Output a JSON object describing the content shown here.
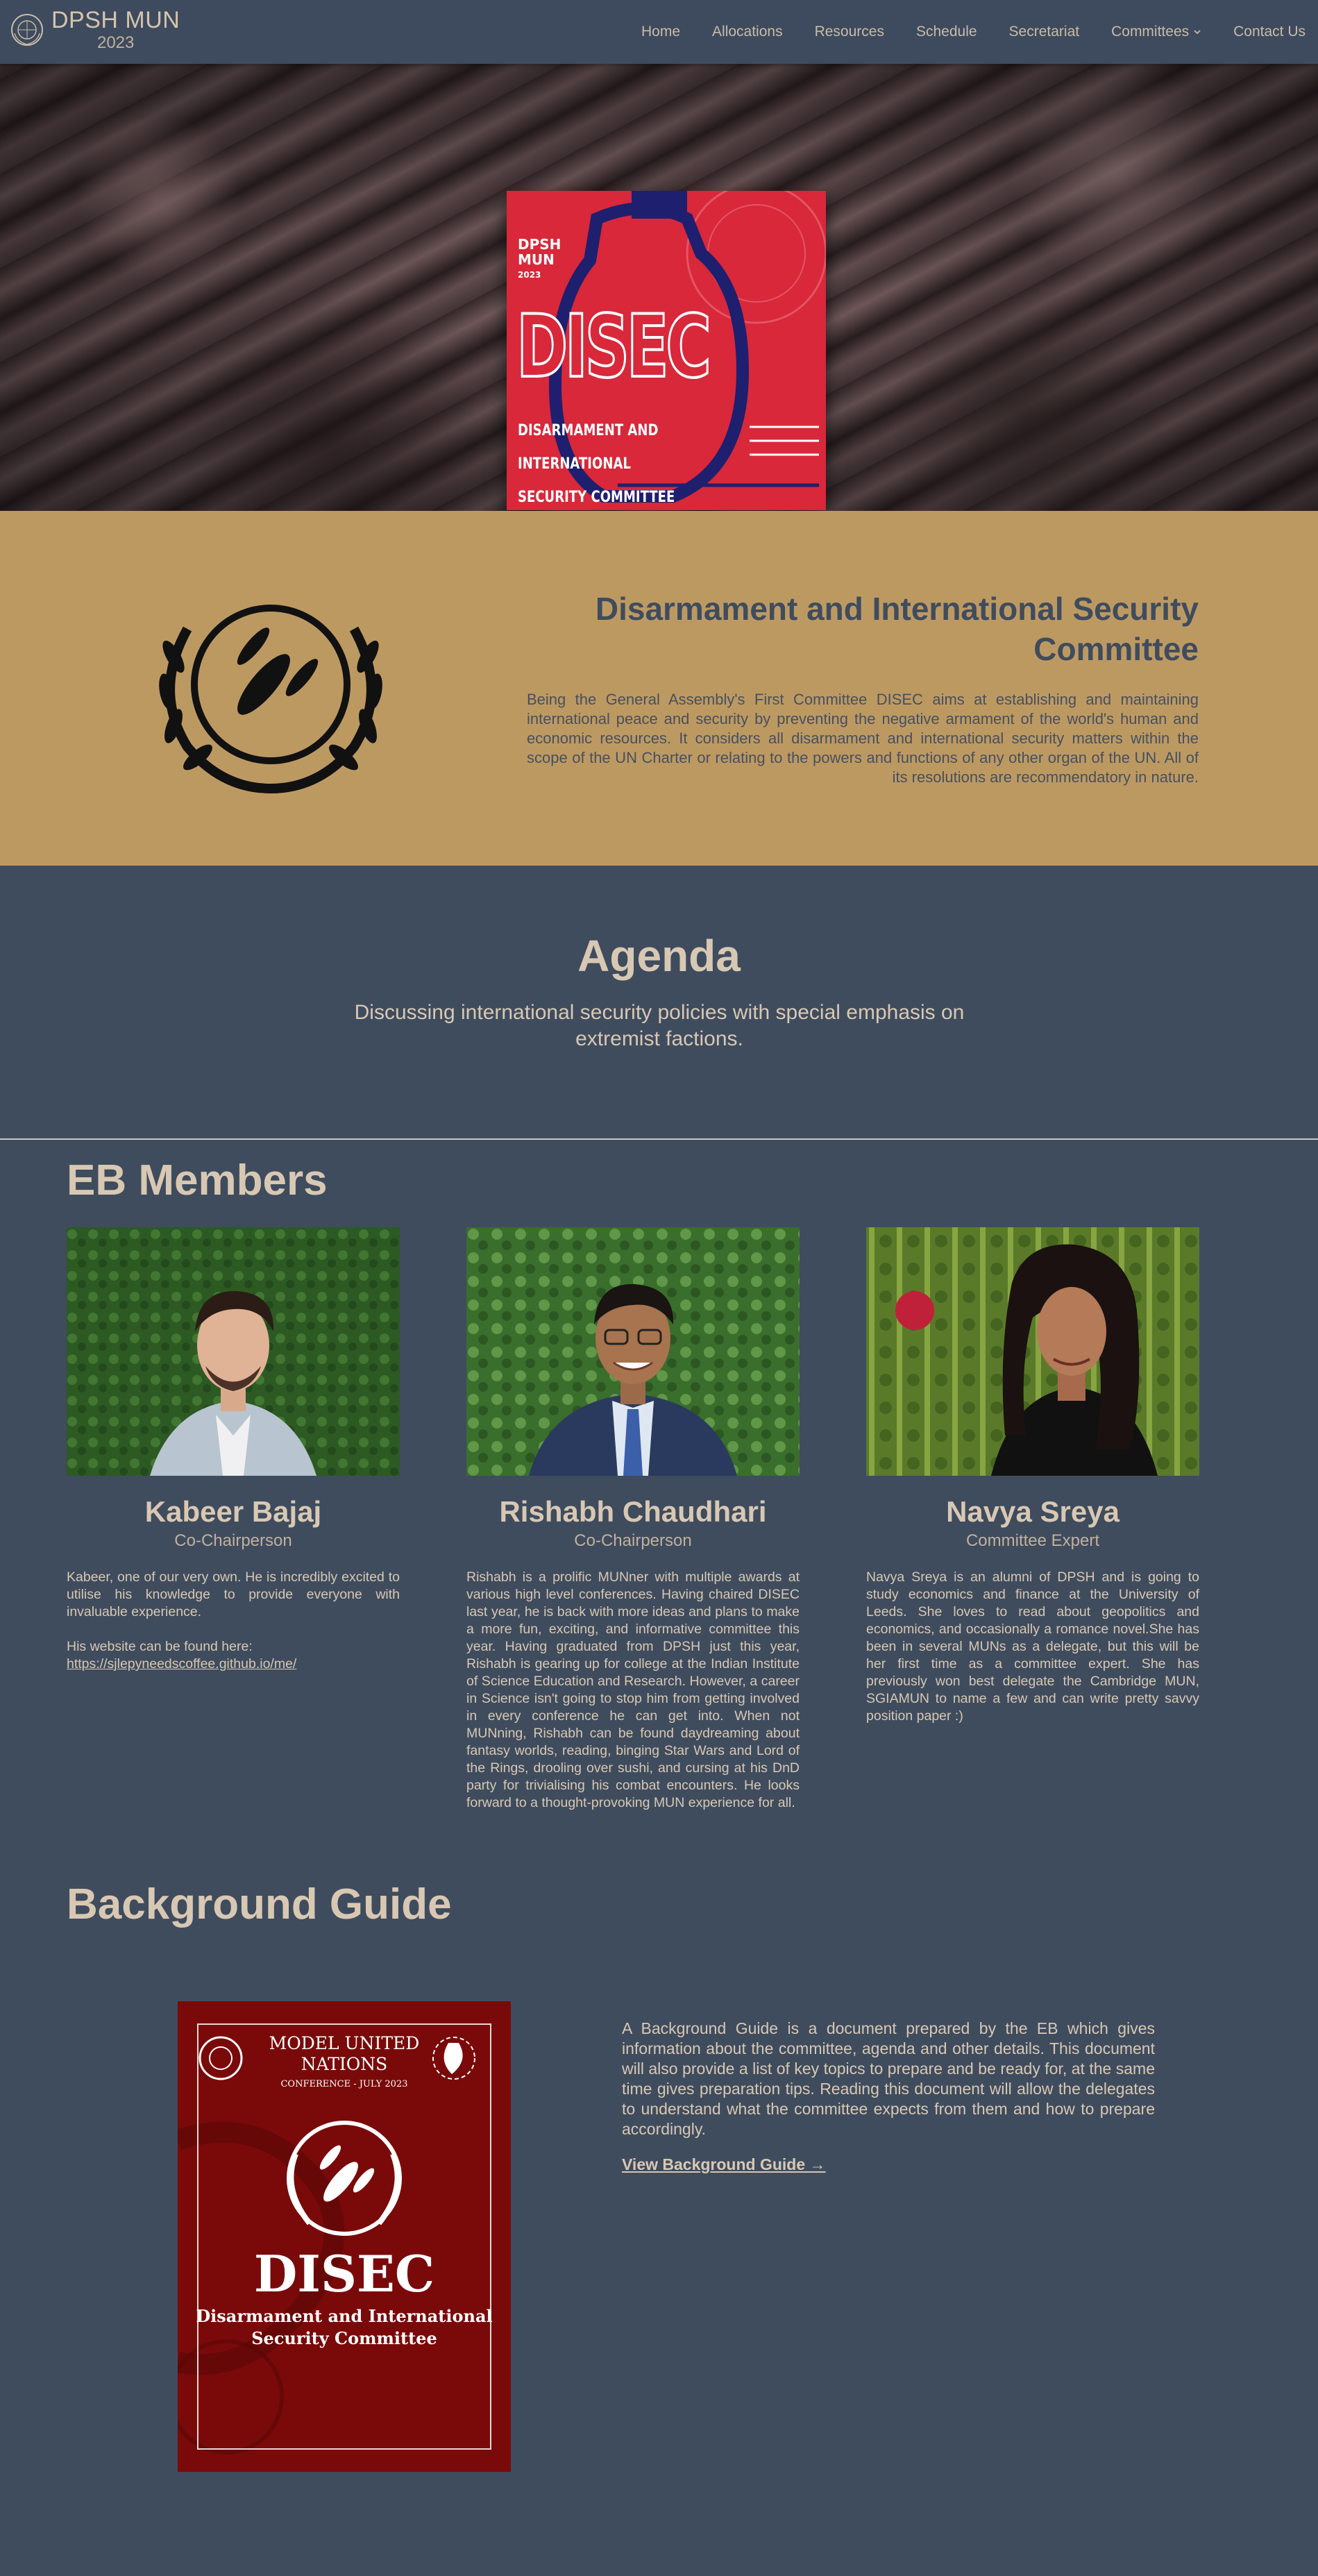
{
  "nav": {
    "brand_name": "DPSH MUN",
    "brand_year": "2023",
    "links": [
      {
        "label": "Home"
      },
      {
        "label": "Allocations"
      },
      {
        "label": "Resources"
      },
      {
        "label": "Schedule"
      },
      {
        "label": "Secretariat"
      },
      {
        "label": "Committees"
      },
      {
        "label": "Contact Us"
      }
    ]
  },
  "hero": {
    "poster_org": "DPSH",
    "poster_org2": "MUN",
    "poster_year": "2023",
    "poster_title": "DISEC",
    "poster_sub1": "DISARMAMENT AND INTERNATIONAL",
    "poster_sub2": "SECURITY COMMITTEE"
  },
  "about": {
    "title": "Disarmament and International Security Committee",
    "text": "Being the General Assembly's First Committee DISEC aims at establishing and maintaining international peace and security by preventing the negative armament of the world's human and economic resources. It considers all disarmament and international security matters within the scope of the UN Charter or relating to the powers and functions of any other organ of the UN. All of its resolutions are recommendatory in nature."
  },
  "agenda": {
    "title": "Agenda",
    "text": "Discussing international security policies with special emphasis on extremist factions."
  },
  "eb": {
    "title": "EB Members",
    "members": [
      {
        "name": "Kabeer Bajaj",
        "role": "Co-Chairperson",
        "bio": "Kabeer, one of our very own. He is incredibly excited to utilise his knowledge to provide everyone with invaluable experience.",
        "bio2": "His website can be found here:",
        "link": "https://sjlepyneedscoffee.github.io/me/"
      },
      {
        "name": "Rishabh Chaudhari",
        "role": "Co-Chairperson",
        "bio": "Rishabh is a prolific MUNner with multiple awards at various high level conferences. Having chaired DISEC last year, he is back with more ideas and plans to make a more fun, exciting, and informative committee this year. Having graduated from DPSH just this year, Rishabh is gearing up for college at the Indian Institute of Science Education and Research. However, a career in Science isn't going to stop him from getting involved in every conference he can get into. When not MUNning, Rishabh can be found daydreaming about fantasy worlds, reading, binging Star Wars and Lord of the Rings, drooling over sushi, and cursing at his DnD party for trivialising his combat encounters. He looks forward to a thought-provoking MUN experience for all."
      },
      {
        "name": "Navya Sreya",
        "role": "Committee Expert",
        "bio": "Navya Sreya is an alumni of DPSH and is going to study economics and finance at the University of Leeds. She loves to read about geopolitics and economics, and occasionally a romance novel.She has been in several MUNs as a delegate, but this will be her first time as a committee expert. She has previously won best delegate the Cambridge MUN, SGIAMUN to name a few and can write pretty savvy position paper :)"
      }
    ]
  },
  "background_guide": {
    "title": "Background Guide",
    "cover_line1": "MODEL UNITED",
    "cover_line2": "NATIONS",
    "cover_conf": "CONFERENCE - JULY 2023",
    "cover_title": "DISEC",
    "cover_full1": "Disarmament and International",
    "cover_full2": "Security Committee",
    "description": "A Background Guide is a document prepared by the EB which gives information about the committee, agenda and other details. This document will also provide a list of key topics to prepare and be ready for, at the same time gives preparation tips. Reading this document will allow the delegates to understand what the committee expects from them and how to prepare accordingly.",
    "link_label": "View Background Guide →"
  }
}
